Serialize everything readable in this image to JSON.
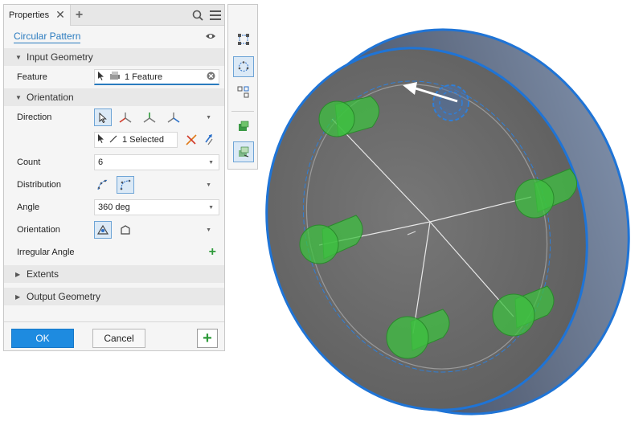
{
  "panel": {
    "tab_label": "Properties",
    "command_title": "Circular Pattern",
    "sections": {
      "input_geometry": "Input Geometry",
      "orientation": "Orientation",
      "extents": "Extents",
      "output_geometry": "Output Geometry"
    },
    "fields": {
      "feature": {
        "label": "Feature",
        "value": "1 Feature"
      },
      "direction": {
        "label": "Direction",
        "selection": "1 Selected"
      },
      "count": {
        "label": "Count",
        "value": "6"
      },
      "distribution": {
        "label": "Distribution"
      },
      "angle": {
        "label": "Angle",
        "value": "360 deg"
      },
      "orientation": {
        "label": "Orientation"
      },
      "irregular_angle": {
        "label": "Irregular Angle"
      }
    },
    "buttons": {
      "ok": "OK",
      "cancel": "Cancel"
    }
  },
  "colors": {
    "accent": "#2a7bbf",
    "ok_button": "#1e8be0",
    "add_green": "#2e9a3a",
    "disc_edge": "#1f74d6",
    "disc_face": "#6a6a6a",
    "pattern_green": "#3ec040"
  },
  "icons": [
    "close-icon",
    "add-tab-icon",
    "search-icon",
    "menu-icon",
    "eye-icon",
    "cursor-icon",
    "feature-icon",
    "clear-icon",
    "axis-icon",
    "flip-icon",
    "plus-icon"
  ]
}
